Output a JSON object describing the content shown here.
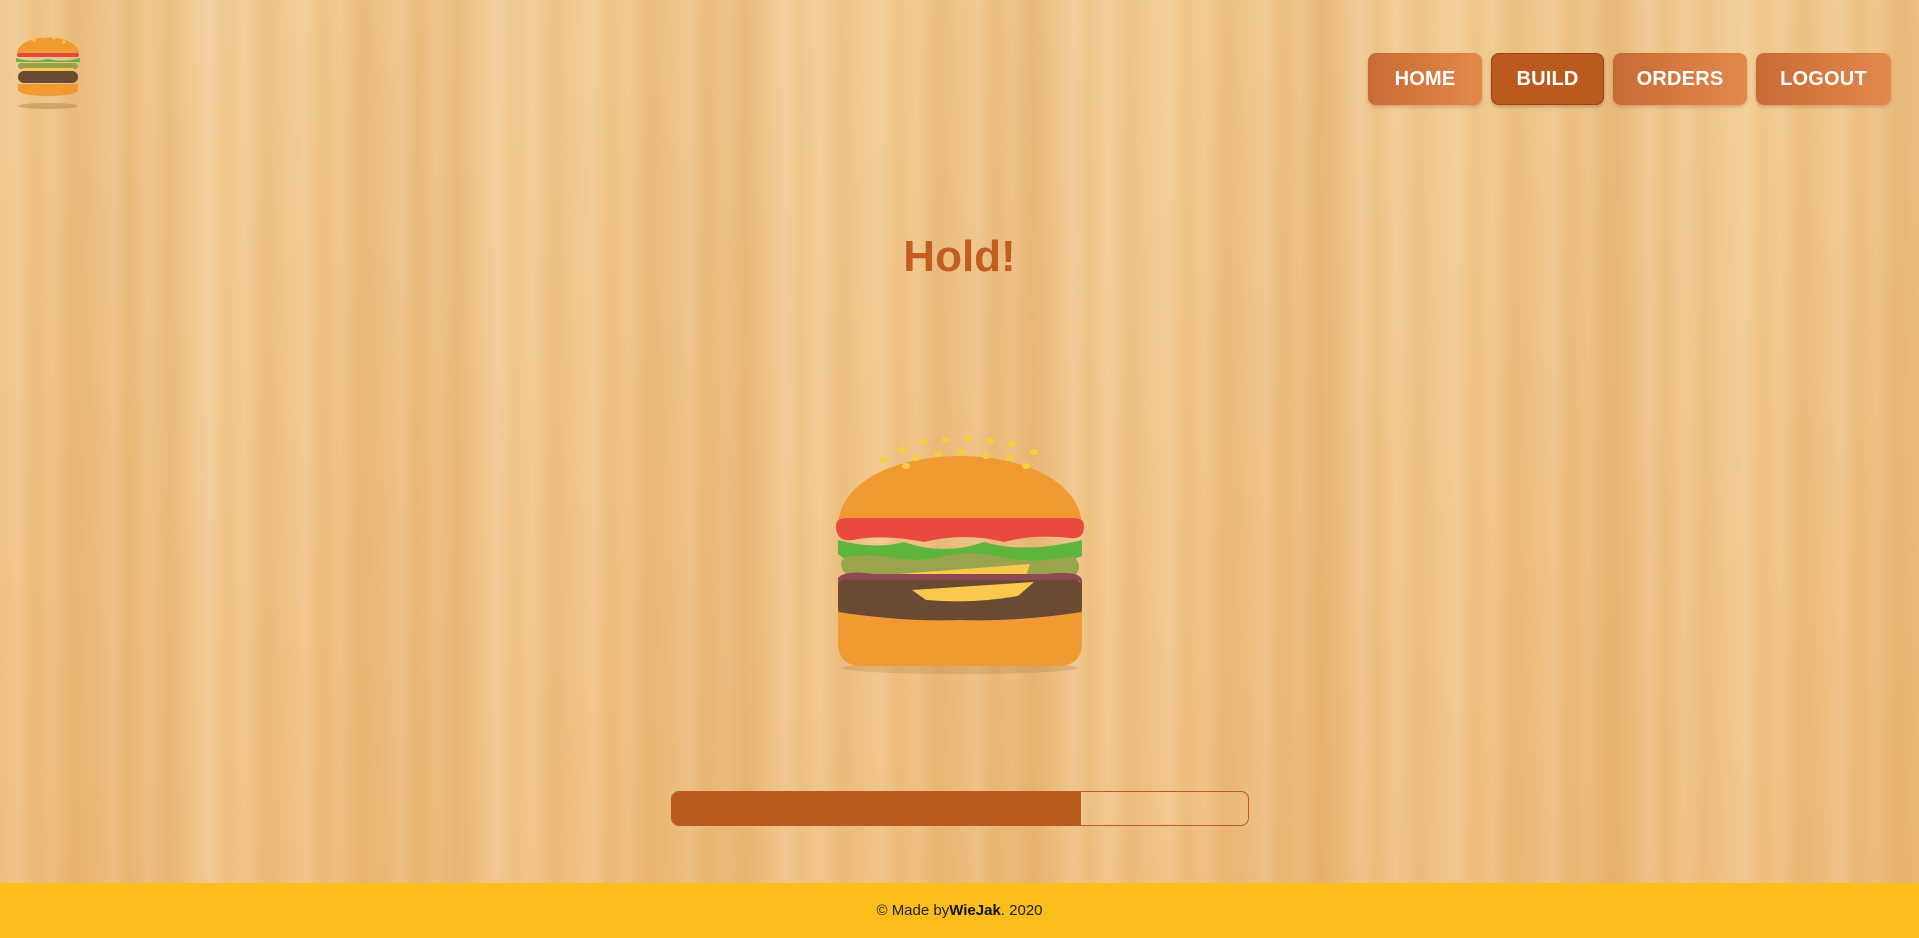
{
  "logo": {
    "icon": "burger-logo-icon"
  },
  "nav": {
    "items": [
      {
        "label": "HOME",
        "active": false
      },
      {
        "label": "BUILD",
        "active": true
      },
      {
        "label": "ORDERS",
        "active": false
      },
      {
        "label": "LOGOUT",
        "active": false
      }
    ]
  },
  "main": {
    "title": "Hold!",
    "burger_icon": "burger-icon",
    "progress": 0.71
  },
  "footer": {
    "prefix": "© Made by ",
    "author": "WieJak",
    "suffix": ". 2020"
  },
  "colors": {
    "accent": "#bb5a1f",
    "title": "#c25d22",
    "footer_bg": "#fbbd1a",
    "background": "#efc285"
  }
}
